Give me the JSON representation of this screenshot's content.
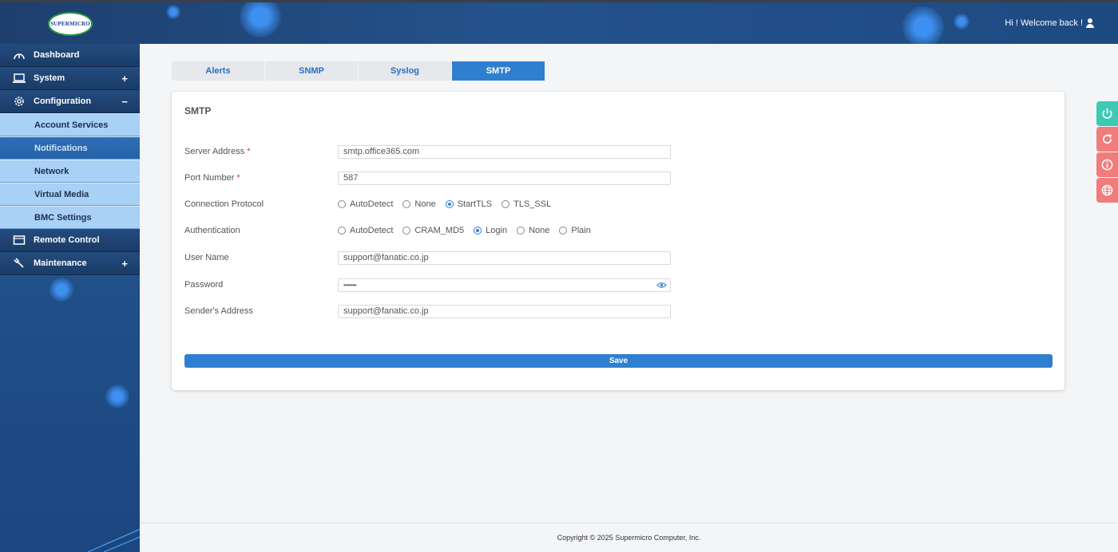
{
  "header": {
    "logo_text": "SUPERMICRO",
    "welcome": "Hi ! Welcome back !"
  },
  "sidebar": {
    "items": [
      {
        "label": "Dashboard",
        "icon": "dashboard-icon"
      },
      {
        "label": "System",
        "icon": "laptop-icon",
        "sign": "+"
      },
      {
        "label": "Configuration",
        "icon": "gear-icon",
        "sign": "−"
      },
      {
        "label": "Remote Control",
        "icon": "monitor-icon"
      },
      {
        "label": "Maintenance",
        "icon": "wrench-icon",
        "sign": "+"
      }
    ],
    "sub_items": [
      {
        "label": "Account Services"
      },
      {
        "label": "Notifications"
      },
      {
        "label": "Network"
      },
      {
        "label": "Virtual Media"
      },
      {
        "label": "BMC Settings"
      }
    ]
  },
  "tabs": [
    {
      "label": "Alerts"
    },
    {
      "label": "SNMP"
    },
    {
      "label": "Syslog"
    },
    {
      "label": "SMTP"
    }
  ],
  "form": {
    "title": "SMTP",
    "server_address": {
      "label": "Server Address",
      "req": "*",
      "value": "smtp.office365.com"
    },
    "port_number": {
      "label": "Port Number",
      "req": "*",
      "value": "587"
    },
    "connection_protocol": {
      "label": "Connection Protocol",
      "options": [
        "AutoDetect",
        "None",
        "StartTLS",
        "TLS_SSL"
      ],
      "selected": "StartTLS"
    },
    "authentication": {
      "label": "Authentication",
      "options": [
        "AutoDetect",
        "CRAM_MD5",
        "Login",
        "None",
        "Plain"
      ],
      "selected": "Login"
    },
    "user_name": {
      "label": "User Name",
      "value": "support@fanatic.co.jp"
    },
    "password": {
      "label": "Password",
      "value": "•••••••"
    },
    "sender_address": {
      "label": "Sender's Address",
      "value": "support@fanatic.co.jp"
    },
    "save_label": "Save"
  },
  "float_buttons": [
    {
      "icon": "power-icon",
      "color": "#3ec9b4"
    },
    {
      "icon": "refresh-icon",
      "color": "#f07c7c"
    },
    {
      "icon": "info-icon",
      "color": "#f07c7c"
    },
    {
      "icon": "globe-icon",
      "color": "#f07c7c"
    }
  ],
  "footer": {
    "copyright": "Copyright © 2025 Supermicro Computer, Inc."
  }
}
